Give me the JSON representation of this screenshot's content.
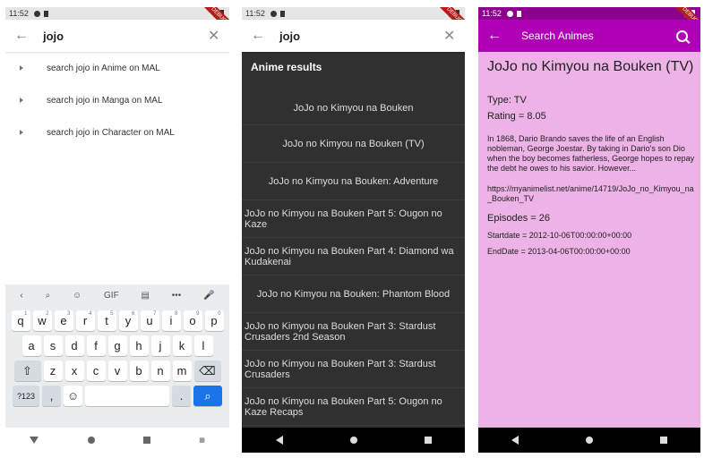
{
  "status": {
    "time": "11:52",
    "debug_label": "DEBUG"
  },
  "search": {
    "query": "jojo"
  },
  "suggestions": [
    {
      "label": "search jojo in Anime on MAL"
    },
    {
      "label": "search jojo in Manga on MAL"
    },
    {
      "label": "search jojo in Character on MAL"
    }
  ],
  "keyboard": {
    "toolbar": [
      "‹",
      "⌕",
      "☺",
      "GIF",
      "▤",
      "•••",
      "🎤"
    ],
    "row1": [
      {
        "k": "q",
        "s": "1"
      },
      {
        "k": "w",
        "s": "2"
      },
      {
        "k": "e",
        "s": "3"
      },
      {
        "k": "r",
        "s": "4"
      },
      {
        "k": "t",
        "s": "5"
      },
      {
        "k": "y",
        "s": "6"
      },
      {
        "k": "u",
        "s": "7"
      },
      {
        "k": "i",
        "s": "8"
      },
      {
        "k": "o",
        "s": "9"
      },
      {
        "k": "p",
        "s": "0"
      }
    ],
    "row2": [
      "a",
      "s",
      "d",
      "f",
      "g",
      "h",
      "j",
      "k",
      "l"
    ],
    "row3": [
      "z",
      "x",
      "c",
      "v",
      "b",
      "n",
      "m"
    ],
    "shift": "⇧",
    "backspace": "⌫",
    "sym": "?123",
    "comma": ",",
    "emoji": "☺",
    "period": ".",
    "action": "⌕"
  },
  "results": {
    "heading": "Anime results",
    "items": [
      "JoJo no Kimyou na Bouken",
      "JoJo no Kimyou na Bouken (TV)",
      "JoJo no Kimyou na Bouken: Adventure",
      "JoJo no Kimyou na Bouken Part 5: Ougon no Kaze",
      "JoJo no Kimyou na Bouken Part 4: Diamond wa Kudakenai",
      "JoJo no Kimyou na Bouken: Phantom Blood",
      "JoJo no Kimyou na Bouken Part 3: Stardust Crusaders 2nd Season",
      "JoJo no Kimyou na Bouken Part 3: Stardust Crusaders",
      "JoJo no Kimyou na Bouken Part 5: Ougon no Kaze Recaps"
    ]
  },
  "detail": {
    "appbar_title": "Search Animes",
    "title": "JoJo no Kimyou na Bouken (TV)",
    "type": "Type: TV",
    "rating": "Rating = 8.05",
    "synopsis": "In 1868, Dario Brando saves the life of an English nobleman, George Joestar. By taking in Dario's son Dio when the boy becomes fatherless, George hopes to repay the debt he owes to his savior. However...",
    "url": "https://myanimelist.net/anime/14719/JoJo_no_Kimyou_na_Bouken_TV",
    "episodes": "Episodes = 26",
    "startdate": "Startdate = 2012-10-06T00:00:00+00:00",
    "enddate": "EndDate = 2013-04-06T00:00:00+00:00"
  },
  "colors": {
    "appbar": "#b000b5",
    "detail_bg": "#edb2e6",
    "results_bg": "#303030",
    "key_action": "#1a73e8"
  }
}
